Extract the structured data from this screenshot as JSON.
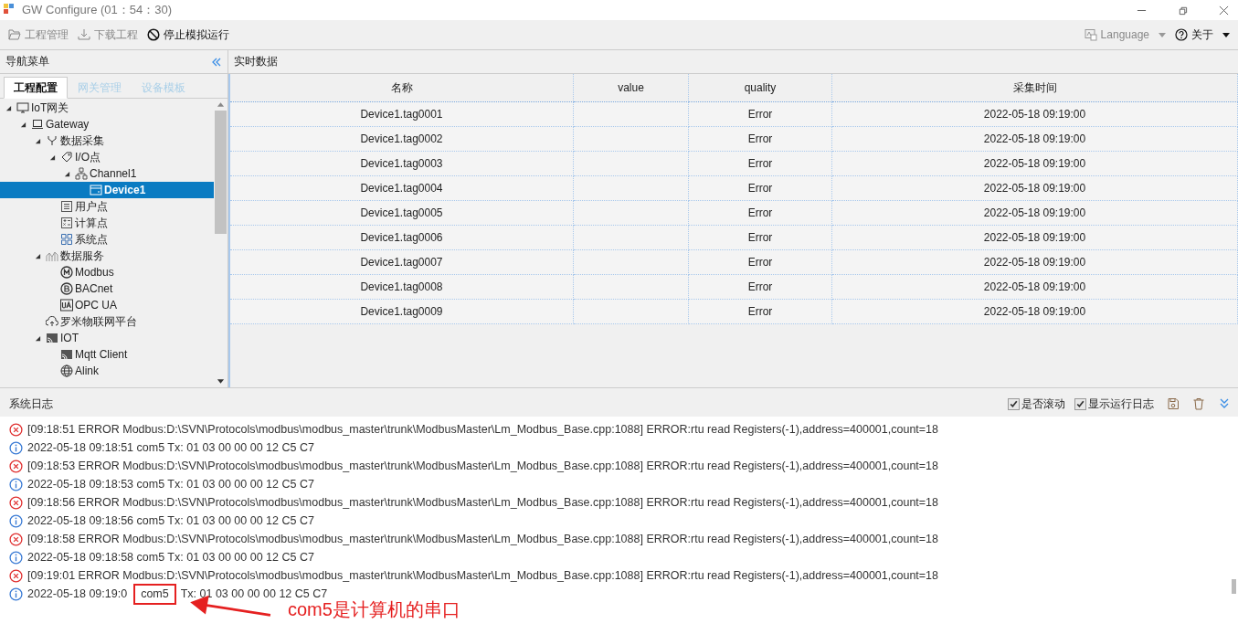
{
  "window": {
    "title": "GW Configure (01：54：30)"
  },
  "toolbar": {
    "left": [
      {
        "label": "工程管理",
        "kind": "folder",
        "disabled": true
      },
      {
        "label": "下载工程",
        "kind": "download",
        "disabled": true
      },
      {
        "label": "停止模拟运行",
        "kind": "stop",
        "disabled": false
      }
    ],
    "right": [
      {
        "label": "Language",
        "kind": "language",
        "disabled": true
      },
      {
        "label": "关于",
        "kind": "help",
        "disabled": false
      }
    ]
  },
  "nav": {
    "title": "导航菜单",
    "tabs": [
      {
        "label": "工程配置",
        "selected": true
      },
      {
        "label": "网关管理",
        "selected": false
      },
      {
        "label": "设备模板",
        "selected": false
      }
    ],
    "tree": [
      {
        "label": "IoT网关",
        "kind": "monitor",
        "expanded": true,
        "selected": false,
        "children": [
          {
            "label": "Gateway",
            "kind": "laptop",
            "expanded": true,
            "selected": false,
            "children": [
              {
                "label": "数据采集",
                "kind": "fork",
                "expanded": true,
                "selected": false,
                "children": [
                  {
                    "label": "I/O点",
                    "kind": "tag",
                    "expanded": true,
                    "selected": false,
                    "children": [
                      {
                        "label": "Channel1",
                        "kind": "network",
                        "expanded": true,
                        "selected": false,
                        "children": [
                          {
                            "label": "Device1",
                            "kind": "device",
                            "selected": true
                          }
                        ]
                      }
                    ]
                  },
                  {
                    "label": "用户点",
                    "kind": "list",
                    "selected": false
                  },
                  {
                    "label": "计算点",
                    "kind": "calc",
                    "selected": false
                  },
                  {
                    "label": "系统点",
                    "kind": "grid",
                    "selected": false
                  }
                ]
              },
              {
                "label": "数据服务",
                "kind": "chart",
                "expanded": true,
                "selected": false,
                "children": [
                  {
                    "label": "Modbus",
                    "kind": "circle-m",
                    "selected": false
                  },
                  {
                    "label": "BACnet",
                    "kind": "circle-b",
                    "selected": false
                  },
                  {
                    "label": "OPC UA",
                    "kind": "ua",
                    "selected": false
                  }
                ]
              },
              {
                "label": "罗米物联网平台",
                "kind": "cloud",
                "selected": false
              },
              {
                "label": "IOT",
                "kind": "cast",
                "expanded": true,
                "selected": false,
                "children": [
                  {
                    "label": "Mqtt Client",
                    "kind": "cast",
                    "selected": false
                  },
                  {
                    "label": "Alink",
                    "kind": "globe",
                    "selected": false
                  }
                ]
              }
            ]
          }
        ]
      }
    ]
  },
  "realtime": {
    "title": "实时数据",
    "table": {
      "columns": [
        "名称",
        "value",
        "quality",
        "采集时间"
      ],
      "rows": [
        [
          "Device1.tag0001",
          "",
          "Error",
          "2022-05-18 09:19:00"
        ],
        [
          "Device1.tag0002",
          "",
          "Error",
          "2022-05-18 09:19:00"
        ],
        [
          "Device1.tag0003",
          "",
          "Error",
          "2022-05-18 09:19:00"
        ],
        [
          "Device1.tag0004",
          "",
          "Error",
          "2022-05-18 09:19:00"
        ],
        [
          "Device1.tag0005",
          "",
          "Error",
          "2022-05-18 09:19:00"
        ],
        [
          "Device1.tag0006",
          "",
          "Error",
          "2022-05-18 09:19:00"
        ],
        [
          "Device1.tag0007",
          "",
          "Error",
          "2022-05-18 09:19:00"
        ],
        [
          "Device1.tag0008",
          "",
          "Error",
          "2022-05-18 09:19:00"
        ],
        [
          "Device1.tag0009",
          "",
          "Error",
          "2022-05-18 09:19:00"
        ]
      ]
    }
  },
  "log": {
    "title": "系统日志",
    "options": [
      {
        "label": "是否滚动",
        "checked": true
      },
      {
        "label": "显示运行日志",
        "checked": true
      }
    ],
    "entries": [
      {
        "kind": "error",
        "text": "[09:18:51 ERROR Modbus:D:\\SVN\\Protocols\\modbus\\modbus_master\\trunk\\ModbusMaster\\Lm_Modbus_Base.cpp:1088] ERROR:rtu read Registers(-1),address=400001,count=18"
      },
      {
        "kind": "info",
        "text": "2022-05-18 09:18:51 com5 Tx: 01 03 00 00 00 12 C5 C7"
      },
      {
        "kind": "error",
        "text": "[09:18:53 ERROR Modbus:D:\\SVN\\Protocols\\modbus\\modbus_master\\trunk\\ModbusMaster\\Lm_Modbus_Base.cpp:1088] ERROR:rtu read Registers(-1),address=400001,count=18"
      },
      {
        "kind": "info",
        "text": "2022-05-18 09:18:53 com5 Tx: 01 03 00 00 00 12 C5 C7"
      },
      {
        "kind": "error",
        "text": "[09:18:56 ERROR Modbus:D:\\SVN\\Protocols\\modbus\\modbus_master\\trunk\\ModbusMaster\\Lm_Modbus_Base.cpp:1088] ERROR:rtu read Registers(-1),address=400001,count=18"
      },
      {
        "kind": "info",
        "text": "2022-05-18 09:18:56 com5 Tx: 01 03 00 00 00 12 C5 C7"
      },
      {
        "kind": "error",
        "text": "[09:18:58 ERROR Modbus:D:\\SVN\\Protocols\\modbus\\modbus_master\\trunk\\ModbusMaster\\Lm_Modbus_Base.cpp:1088] ERROR:rtu read Registers(-1),address=400001,count=18"
      },
      {
        "kind": "info",
        "text": "2022-05-18 09:18:58 com5 Tx: 01 03 00 00 00 12 C5 C7"
      },
      {
        "kind": "error",
        "text": "[09:19:01 ERROR Modbus:D:\\SVN\\Protocols\\modbus\\modbus_master\\trunk\\ModbusMaster\\Lm_Modbus_Base.cpp:1088] ERROR:rtu read Registers(-1),address=400001,count=18"
      },
      {
        "kind": "info",
        "text": "2022-05-18 09:19:0",
        "highlight": "com5",
        "tail": "Tx: 01 03 00 00 00 12 C5 C7"
      }
    ]
  },
  "annotation": {
    "label": "com5是计算机的串口"
  }
}
